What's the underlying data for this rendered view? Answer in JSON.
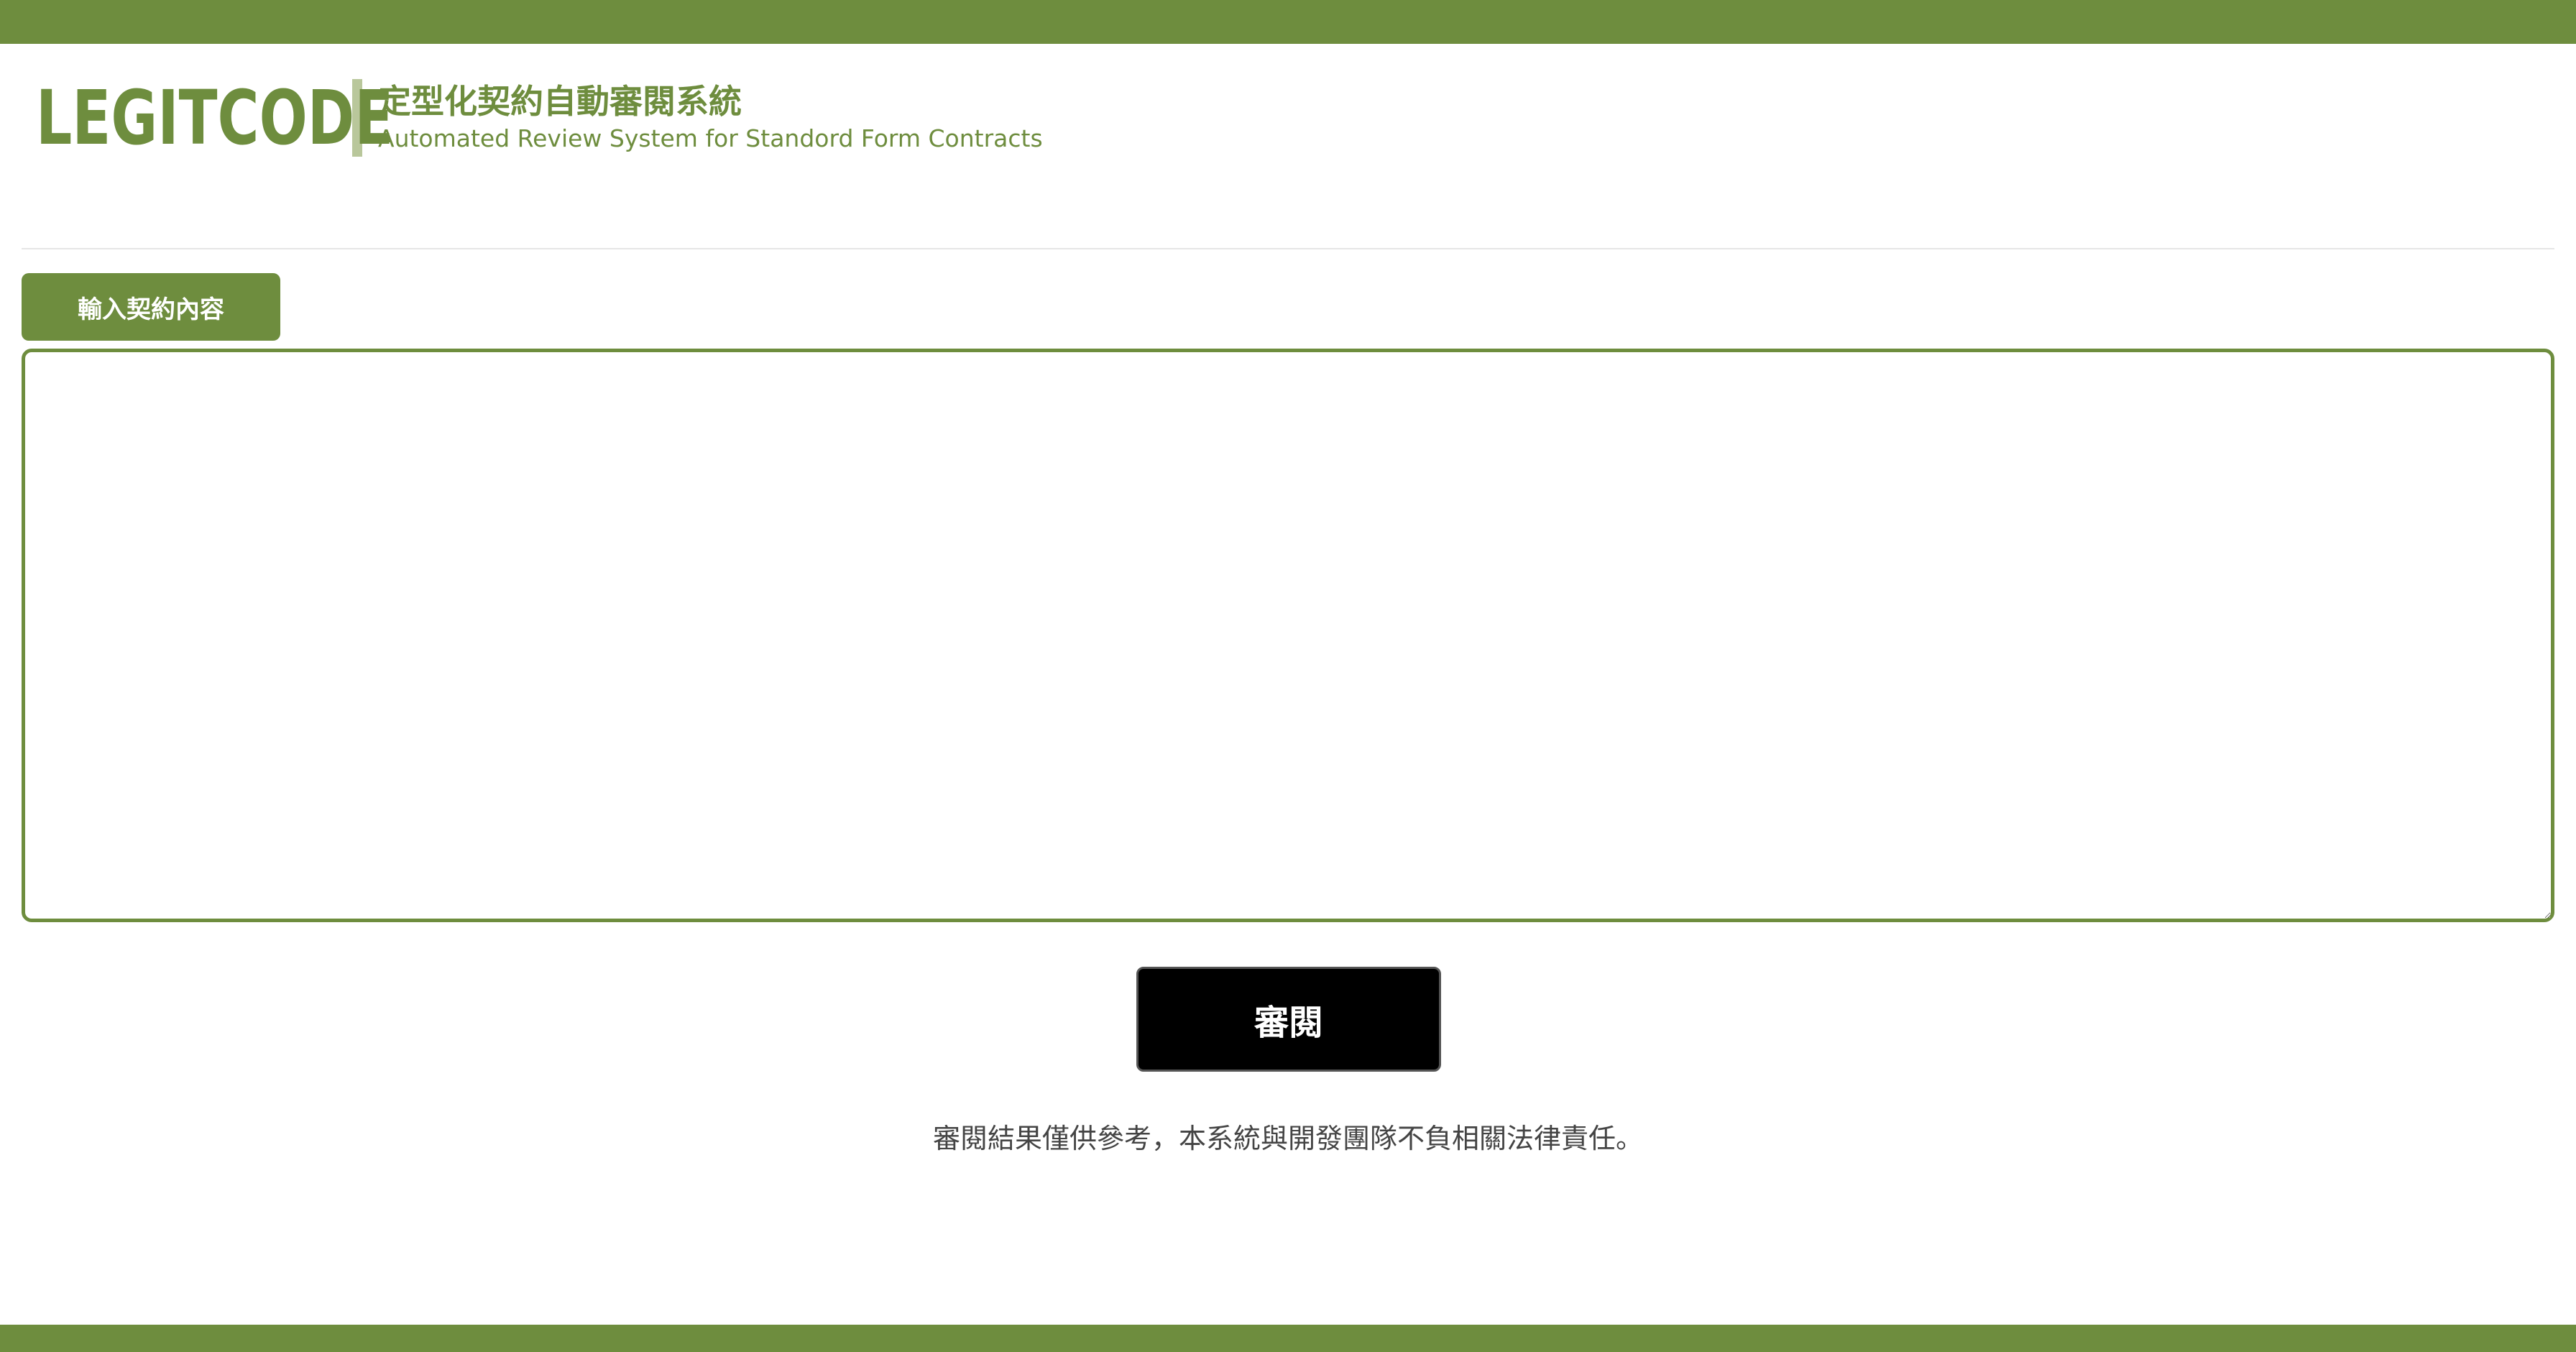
{
  "header": {
    "logo_text": "LEGITCODE",
    "title_zh": "定型化契約自動審閱系統",
    "title_en": "Automated Review System for Standord Form Contracts"
  },
  "input": {
    "tab_label": "輸入契約內容",
    "value": "",
    "placeholder": ""
  },
  "actions": {
    "review_label": "審閱"
  },
  "footer": {
    "disclaimer": "審閱結果僅供參考，本系統與開發團隊不負相關法律責任。"
  },
  "colors": {
    "brand_green": "#6e8d3e",
    "divider_accent": "#b9c79b",
    "button_black": "#000000"
  }
}
